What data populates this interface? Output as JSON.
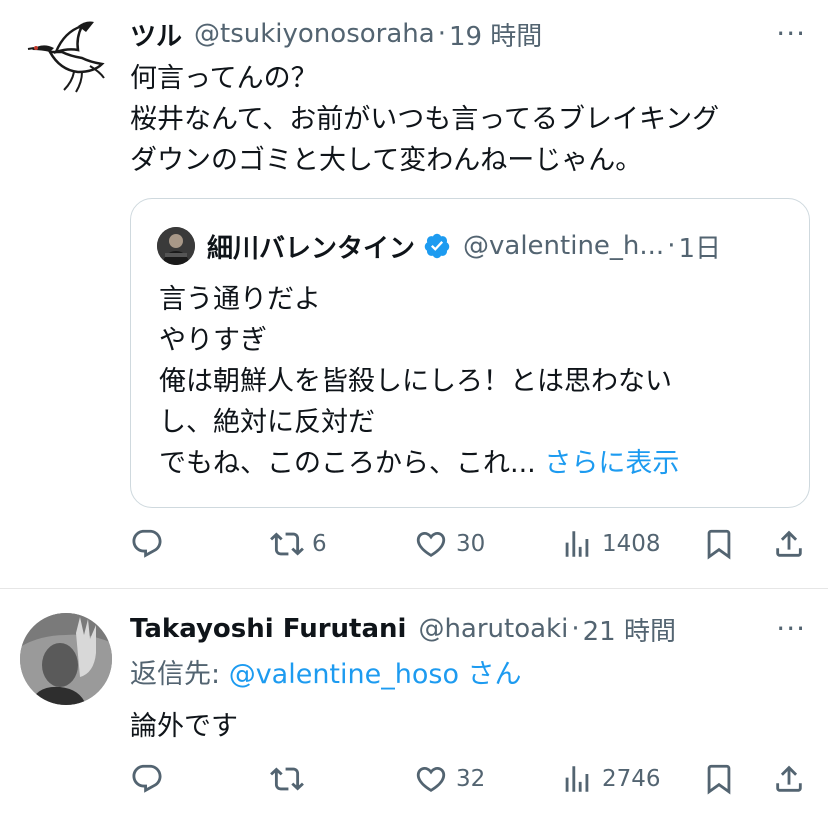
{
  "tweets": [
    {
      "name": "ツル",
      "handle": "@tsukiyonosoraha",
      "separator": "·",
      "time": "19 時間",
      "more": "···",
      "text_lines": [
        "何言ってんの？",
        "桜井なんて、お前がいつも言ってるブレイキング",
        "ダウンのゴミと大して変わんねーじゃん。"
      ],
      "quote": {
        "name": "細川バレンタイン",
        "handle": "@valentine_h...",
        "separator": "·",
        "time": "1日",
        "verified_icon": "verified-badge-icon",
        "text_lines": [
          "言う通りだよ",
          "やりすぎ",
          "俺は朝鮮人を皆殺しにしろ！とは思わない",
          "し、絶対に反対だ",
          "でもね、このころから、これ... "
        ],
        "show_more": "さらに表示"
      },
      "actions": {
        "reply": "",
        "retweet": "6",
        "like": "30",
        "views": "1408"
      }
    },
    {
      "name": "Takayoshi Furutani",
      "handle": "@harutoaki",
      "separator": "·",
      "time": "21 時間",
      "more": "···",
      "reply_prefix": "返信先: ",
      "reply_mention": "@valentine_hoso",
      "reply_suffix": " さん",
      "text_lines": [
        "論外です"
      ],
      "actions": {
        "reply": "",
        "retweet": "",
        "like": "32",
        "views": "2746"
      }
    }
  ],
  "colors": {
    "text": "#0f1419",
    "secondary": "#536471",
    "link": "#1d9bf0",
    "border": "#cfd9de"
  }
}
